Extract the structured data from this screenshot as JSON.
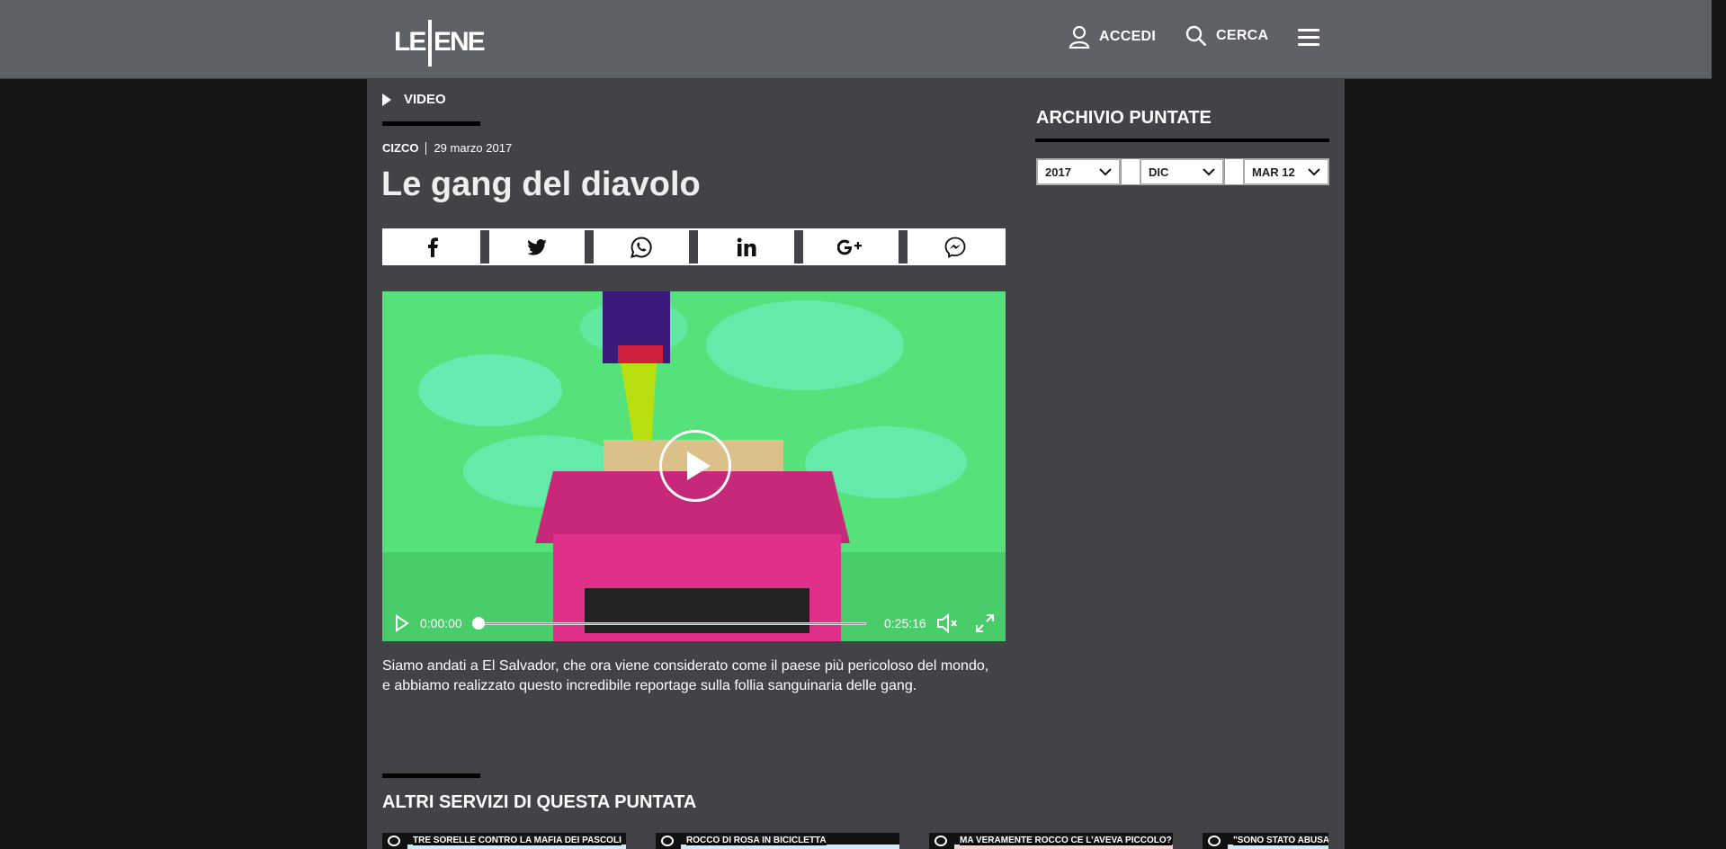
{
  "header": {
    "logo_text_left": "LE",
    "logo_text_right": "ENE",
    "login_label": "ACCEDI",
    "search_label": "CERCA"
  },
  "article": {
    "section_label": "VIDEO",
    "author": "CIZCO",
    "date": "29 marzo 2017",
    "title": "Le gang del diavolo",
    "share": [
      "facebook-icon",
      "twitter-icon",
      "whatsapp-icon",
      "linkedin-icon",
      "google-plus-icon",
      "messenger-icon"
    ],
    "description": "Siamo andati a El Salvador, che ora viene considerato come il paese più pericoloso del mondo, e abbiamo realizzato questo incredibile reportage sulla follia sanguinaria delle gang."
  },
  "player": {
    "current_time": "0:00:00",
    "duration": "0:25:16",
    "progress": 0
  },
  "related": {
    "title": "ALTRI SERVIZI DI QUESTA PUNTATA",
    "items": [
      {
        "title": "TRE SORELLE CONTRO LA MAFIA DEI PASCOLI"
      },
      {
        "title": "ROCCO DI ROSA IN BICICLETTA"
      },
      {
        "title": "MA VERAMENTE ROCCO CE L'AVEVA PICCOLO?"
      },
      {
        "title": "\"SONO STATO ABUSATO DA"
      }
    ]
  },
  "archive": {
    "title": "ARCHIVIO PUNTATE",
    "year": "2017",
    "month": "DIC",
    "episode": "MAR 12"
  },
  "colors": {
    "topbar": "#5d6064",
    "content_bg": "#434247",
    "page_bg": "#141414"
  }
}
